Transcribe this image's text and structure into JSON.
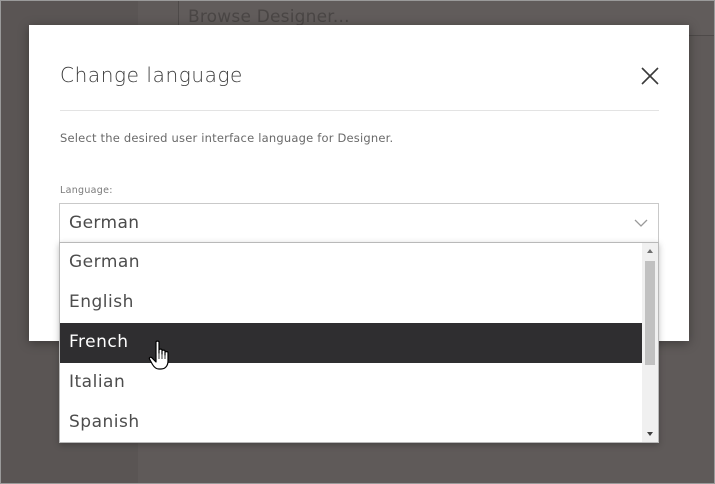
{
  "background": {
    "search_placeholder": "Browse Designer..."
  },
  "dialog": {
    "title": "Change language",
    "description": "Select the desired user interface language for Designer.",
    "field_label": "Language:",
    "selected_value": "German",
    "options": [
      "German",
      "English",
      "French",
      "Italian",
      "Spanish"
    ],
    "highlighted_option": "French"
  },
  "colors": {
    "backdrop": "#5f5a59",
    "highlight": "#2f2e30"
  },
  "icons": {
    "close": "close-icon",
    "chevron": "chevron-down-icon",
    "cursor": "hand-pointer-icon"
  }
}
